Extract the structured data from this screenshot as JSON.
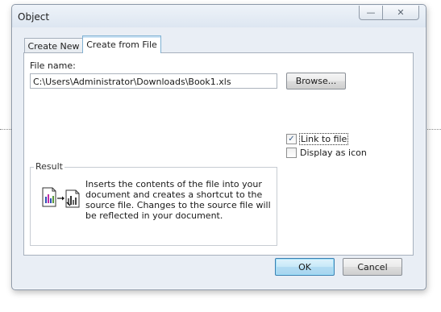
{
  "dialog": {
    "title": "Object",
    "minimize_glyph": "—",
    "close_glyph": "✕"
  },
  "tabs": [
    {
      "label": "Create New",
      "active": false
    },
    {
      "label": "Create from File",
      "active": true
    }
  ],
  "file": {
    "label": "File name:",
    "value": "C:\\Users\\Administrator\\Downloads\\Book1.xls",
    "browse_label": "Browse..."
  },
  "options": {
    "link_to_file": {
      "label": "Link to file",
      "checked": true
    },
    "display_as_icon": {
      "label": "Display as icon",
      "checked": false
    }
  },
  "result": {
    "legend": "Result",
    "text": "Inserts the contents of the file into your document and creates a shortcut to the source file.  Changes to the source file will be reflected in your document."
  },
  "buttons": {
    "ok_label": "OK",
    "cancel_label": "Cancel"
  },
  "colors": {
    "ok_accent": "#a7d5ef",
    "active_tab_border": "#7fb1d3"
  }
}
